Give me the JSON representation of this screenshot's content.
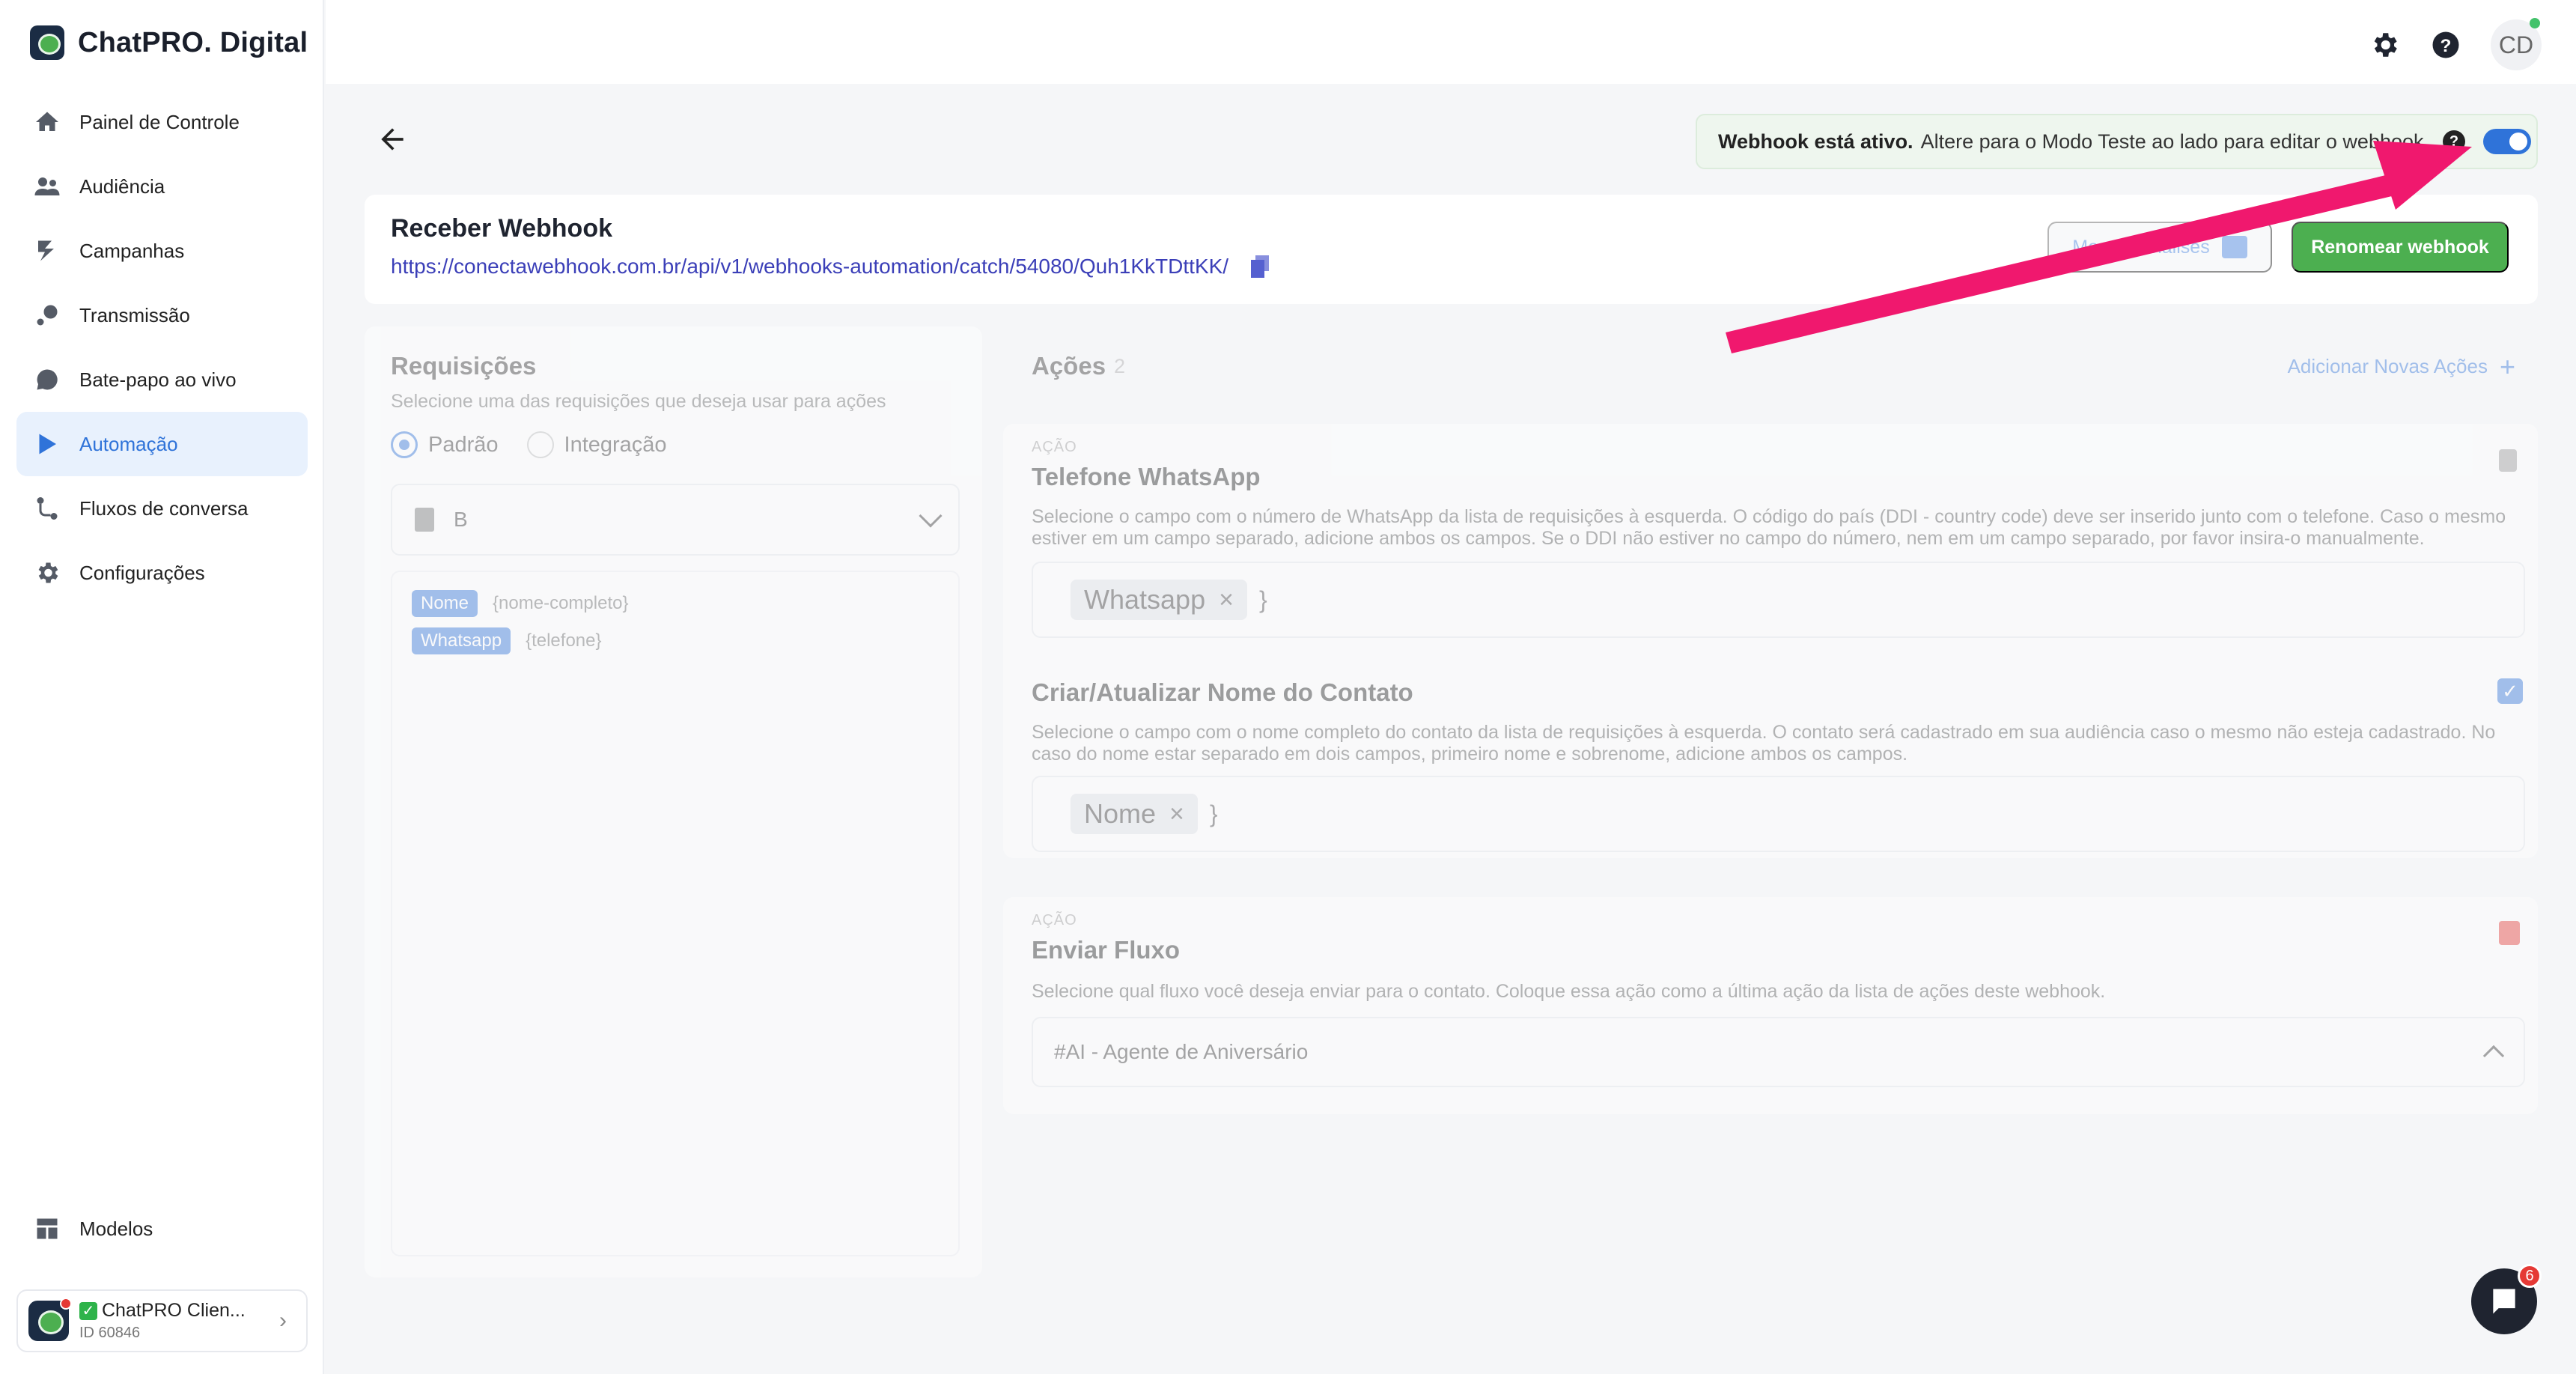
{
  "brand": {
    "name": "ChatPRO. Digital"
  },
  "sidebar": {
    "items": [
      {
        "label": "Painel de Controle",
        "icon": "home-icon"
      },
      {
        "label": "Audiência",
        "icon": "users-icon"
      },
      {
        "label": "Campanhas",
        "icon": "campaign-icon"
      },
      {
        "label": "Transmissão",
        "icon": "broadcast-icon"
      },
      {
        "label": "Bate-papo ao vivo",
        "icon": "chat-icon"
      },
      {
        "label": "Automação",
        "icon": "automation-icon",
        "active": true
      },
      {
        "label": "Fluxos de conversa",
        "icon": "flow-icon"
      },
      {
        "label": "Configurações",
        "icon": "gear-icon"
      }
    ],
    "bottom": {
      "label": "Modelos",
      "icon": "templates-icon"
    },
    "account": {
      "check": "✓",
      "name": "ChatPRO Clien...",
      "id": "ID 60846"
    }
  },
  "topbar": {
    "user_initials": "CD"
  },
  "status": {
    "bold": "Webhook está ativo.",
    "text": "Altere para o Modo Teste ao lado para editar o webhook.",
    "help": "?"
  },
  "webhook": {
    "title": "Receber Webhook",
    "url": "https://conectawebhook.com.br/api/v1/webhooks-automation/catch/54080/Quh1KkTDttKK/",
    "analysis_label": "Mostrar análises",
    "rename_label": "Renomear webhook"
  },
  "requests": {
    "title": "Requisições",
    "subtitle": "Selecione uma das requisições que deseja usar para ações",
    "radio_default": "Padrão",
    "radio_integration": "Integração",
    "selected": "B",
    "fields": [
      {
        "tag": "Nome",
        "key": "{nome-completo}"
      },
      {
        "tag": "Whatsapp",
        "key": "{telefone}"
      }
    ]
  },
  "actions": {
    "title": "Ações",
    "count": "2",
    "add_label": "Adicionar Novas Ações",
    "card1": {
      "label": "AÇÃO",
      "phone_title": "Telefone WhatsApp",
      "phone_desc": "Selecione o campo com o número de WhatsApp da lista de requisições à esquerda. O código do país (DDI - country code) deve ser inserido junto com o telefone. Caso o mesmo estiver em um campo separado, adicione ambos os campos. Se o DDI não estiver no campo do número, nem em um campo separado, por favor insira-o manualmente.",
      "phone_tag": "Whatsapp",
      "name_title": "Criar/Atualizar Nome do Contato",
      "name_desc": "Selecione o campo com o nome completo do contato da lista de requisições à esquerda. O contato será cadastrado em sua audiência caso o mesmo não esteja cadastrado. No caso do nome estar separado em dois campos, primeiro nome e sobrenome, adicione ambos os campos.",
      "name_tag": "Nome"
    },
    "card2": {
      "label": "AÇÃO",
      "title": "Enviar Fluxo",
      "desc": "Selecione qual fluxo você deseja enviar para o contato. Coloque essa ação como a última ação da lista de ações deste webhook.",
      "selected_flow": "#AI - Agente de Aniversário"
    }
  },
  "chat": {
    "badge": "6"
  },
  "colors": {
    "accent": "#2f73d9",
    "success": "#4caf50",
    "annotation": "#f0186e"
  }
}
